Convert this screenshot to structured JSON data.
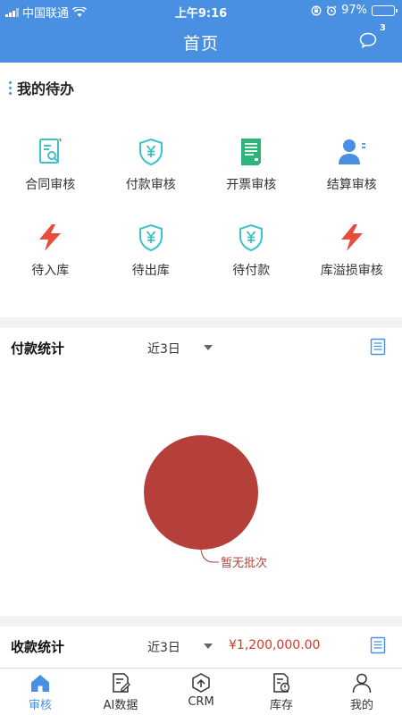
{
  "status_bar": {
    "carrier": "中国联通",
    "time": "上午9:16",
    "battery_text": "97%",
    "battery_level": 0.97
  },
  "nav": {
    "title": "首页",
    "message_badge": "3"
  },
  "todo": {
    "title": "我的待办",
    "items": [
      {
        "label": "合同审核",
        "icon": "contract-search-icon",
        "color": "#3fc1c9"
      },
      {
        "label": "付款审核",
        "icon": "yuan-shield-icon",
        "color": "#3fc1c9"
      },
      {
        "label": "开票审核",
        "icon": "invoice-document-icon",
        "color": "#2fb37c"
      },
      {
        "label": "结算审核",
        "icon": "user-list-icon",
        "color": "#4a90e2"
      },
      {
        "label": "待入库",
        "icon": "lightning-icon",
        "color": "#e74c3c"
      },
      {
        "label": "待出库",
        "icon": "yuan-shield-icon",
        "color": "#3fc1c9"
      },
      {
        "label": "待付款",
        "icon": "yuan-shield-icon",
        "color": "#3fc1c9"
      },
      {
        "label": "库溢损审核",
        "icon": "lightning-icon",
        "color": "#e74c3c"
      }
    ]
  },
  "payment_stats": {
    "title": "付款统计",
    "period": "近3日",
    "chart_data": {
      "type": "pie",
      "slices": [
        {
          "label": "暂无批次",
          "value": 1,
          "color": "#b5403a"
        }
      ]
    }
  },
  "receipt_stats": {
    "title": "收款统计",
    "period": "近3日",
    "amount": "¥1,200,000.00"
  },
  "tabbar": {
    "items": [
      {
        "label": "审核",
        "icon": "home-icon",
        "active": true
      },
      {
        "label": "AI数据",
        "icon": "ai-data-icon",
        "active": false
      },
      {
        "label": "CRM",
        "icon": "crm-icon",
        "active": false
      },
      {
        "label": "库存",
        "icon": "inventory-icon",
        "active": false
      },
      {
        "label": "我的",
        "icon": "profile-icon",
        "active": false
      }
    ]
  },
  "colors": {
    "primary": "#4a90e2",
    "accent_red": "#d03a2a",
    "background": "#f2f2f4"
  }
}
